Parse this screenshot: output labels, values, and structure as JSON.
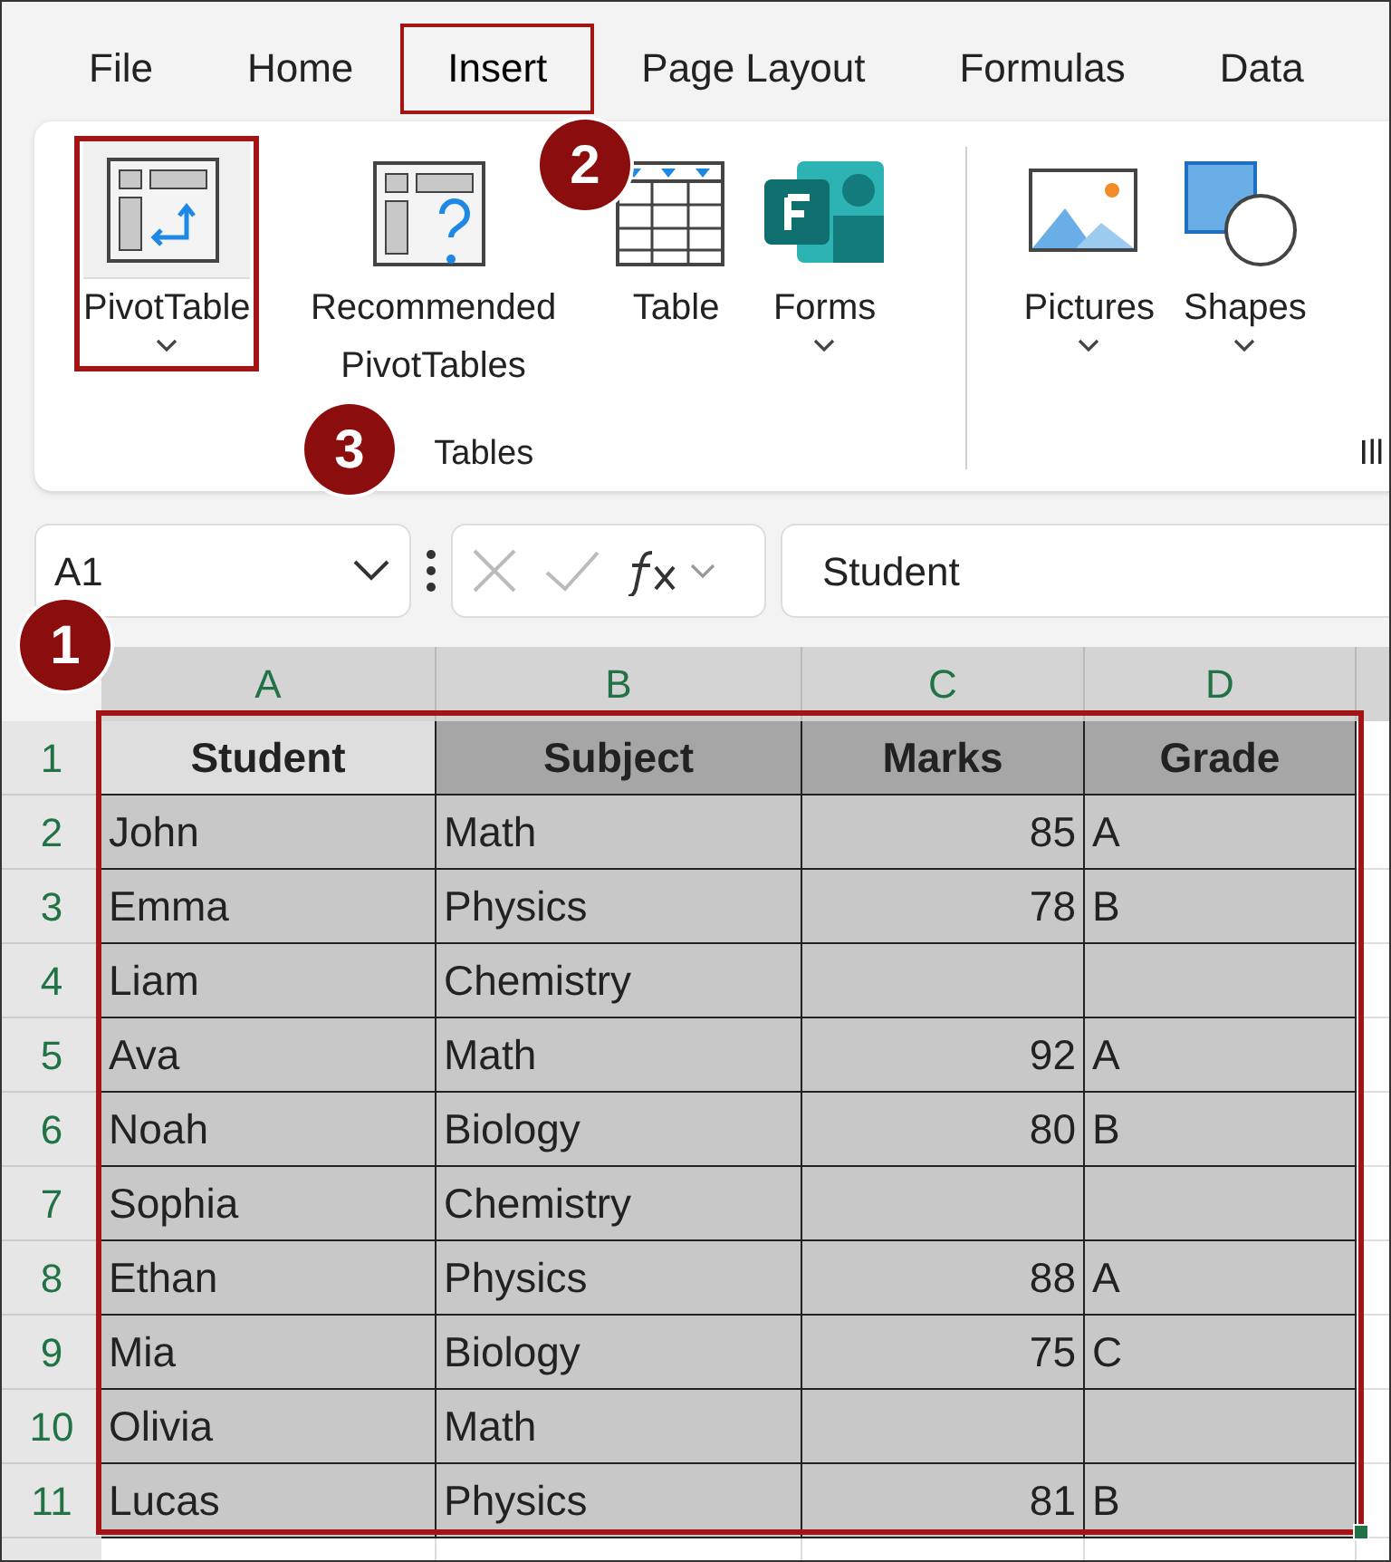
{
  "tabs": [
    {
      "label": "File",
      "selected": false,
      "highlighted": false
    },
    {
      "label": "Home",
      "selected": false,
      "highlighted": false
    },
    {
      "label": "Insert",
      "selected": true,
      "highlighted": true
    },
    {
      "label": "Page Layout",
      "selected": false,
      "highlighted": false
    },
    {
      "label": "Formulas",
      "selected": false,
      "highlighted": false
    },
    {
      "label": "Data",
      "selected": false,
      "highlighted": false
    }
  ],
  "ribbon": {
    "groups": [
      {
        "label": "Tables",
        "items": [
          {
            "label": "PivotTable",
            "dropdown": true,
            "highlighted": true
          },
          {
            "label": "Recommended PivotTables",
            "dropdown": false,
            "highlighted": false
          },
          {
            "label": "Table",
            "dropdown": false,
            "highlighted": false
          },
          {
            "label": "Forms",
            "dropdown": true,
            "highlighted": false
          }
        ]
      },
      {
        "label": "Ill",
        "items": [
          {
            "label": "Pictures",
            "dropdown": true,
            "highlighted": false
          },
          {
            "label": "Shapes",
            "dropdown": true,
            "highlighted": false
          }
        ]
      }
    ]
  },
  "name_box": {
    "value": "A1"
  },
  "formula_bar": {
    "value": "Student"
  },
  "sheet": {
    "columns": [
      {
        "label": "A",
        "selected": true
      },
      {
        "label": "B",
        "selected": true
      },
      {
        "label": "C",
        "selected": true
      },
      {
        "label": "D",
        "selected": true
      }
    ],
    "rows": [
      {
        "number": "1",
        "header": true,
        "cells": [
          "Student",
          "Subject",
          "Marks",
          "Grade"
        ]
      },
      {
        "number": "2",
        "header": false,
        "cells": [
          "John",
          "Math",
          "85",
          "A"
        ]
      },
      {
        "number": "3",
        "header": false,
        "cells": [
          "Emma",
          "Physics",
          "78",
          "B"
        ]
      },
      {
        "number": "4",
        "header": false,
        "cells": [
          "Liam",
          "Chemistry",
          "",
          ""
        ]
      },
      {
        "number": "5",
        "header": false,
        "cells": [
          "Ava",
          "Math",
          "92",
          "A"
        ]
      },
      {
        "number": "6",
        "header": false,
        "cells": [
          "Noah",
          "Biology",
          "80",
          "B"
        ]
      },
      {
        "number": "7",
        "header": false,
        "cells": [
          "Sophia",
          "Chemistry",
          "",
          ""
        ]
      },
      {
        "number": "8",
        "header": false,
        "cells": [
          "Ethan",
          "Physics",
          "88",
          "A"
        ]
      },
      {
        "number": "9",
        "header": false,
        "cells": [
          "Mia",
          "Biology",
          "75",
          "C"
        ]
      },
      {
        "number": "10",
        "header": false,
        "cells": [
          "Olivia",
          "Math",
          "",
          ""
        ]
      },
      {
        "number": "11",
        "header": false,
        "cells": [
          "Lucas",
          "Physics",
          "81",
          "B"
        ]
      }
    ]
  },
  "step_markers": [
    {
      "label": "1"
    },
    {
      "label": "2"
    },
    {
      "label": "3"
    }
  ]
}
